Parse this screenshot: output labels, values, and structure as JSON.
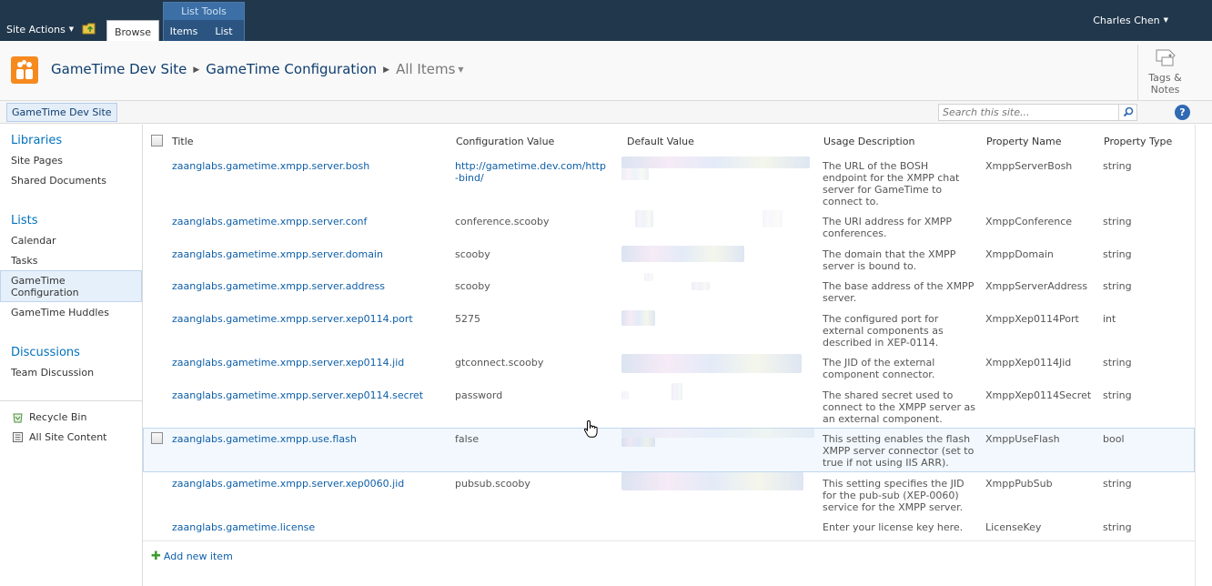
{
  "ribbon": {
    "site_actions": "Site Actions",
    "tab_browse": "Browse",
    "list_tools_title": "List Tools",
    "tab_items": "Items",
    "tab_list": "List",
    "user": "Charles Chen"
  },
  "breadcrumb": {
    "site": "GameTime Dev Site",
    "list": "GameTime Configuration",
    "view": "All Items"
  },
  "tags_notes": {
    "line1": "Tags &",
    "line2": "Notes"
  },
  "topnav": {
    "site": "GameTime Dev Site",
    "search_placeholder": "Search this site...",
    "help": "?"
  },
  "quick_launch": {
    "libraries_heading": "Libraries",
    "libraries": [
      "Site Pages",
      "Shared Documents"
    ],
    "lists_heading": "Lists",
    "lists": [
      "Calendar",
      "Tasks",
      "GameTime Configuration",
      "GameTime Huddles"
    ],
    "discussions_heading": "Discussions",
    "discussions": [
      "Team Discussion"
    ],
    "recycle_bin": "Recycle Bin",
    "all_site_content": "All Site Content"
  },
  "columns": {
    "title": "Title",
    "config_value": "Configuration Value",
    "default_value": "Default Value",
    "usage_description": "Usage Description",
    "property_name": "Property Name",
    "property_type": "Property Type"
  },
  "rows": [
    {
      "title": "zaanglabs.gametime.xmpp.server.bosh",
      "value": "http://gametime.dev.com/http-bind/",
      "value_line1": "http://gametime.dev.com/http",
      "value_line2": "-bind/",
      "desc": "The URL of the BOSH endpoint for the XMPP chat server for GameTime to connect to.",
      "prop": "XmppServerBosh",
      "type": "string"
    },
    {
      "title": "zaanglabs.gametime.xmpp.server.conf",
      "value": "conference.scooby",
      "desc": "The URI address for XMPP conferences.",
      "prop": "XmppConference",
      "type": "string"
    },
    {
      "title": "zaanglabs.gametime.xmpp.server.domain",
      "value": "scooby",
      "desc": "The domain that the XMPP server is bound to.",
      "prop": "XmppDomain",
      "type": "string"
    },
    {
      "title": "zaanglabs.gametime.xmpp.server.address",
      "value": "scooby",
      "desc": "The base address of the XMPP server.",
      "prop": "XmppServerAddress",
      "type": "string"
    },
    {
      "title": "zaanglabs.gametime.xmpp.server.xep0114.port",
      "value": "5275",
      "desc": "The configured port for external components as described in XEP-0114.",
      "prop": "XmppXep0114Port",
      "type": "int"
    },
    {
      "title": "zaanglabs.gametime.xmpp.server.xep0114.jid",
      "value": "gtconnect.scooby",
      "desc": "The JID of the external component connector.",
      "prop": "XmppXep0114Jid",
      "type": "string"
    },
    {
      "title": "zaanglabs.gametime.xmpp.server.xep0114.secret",
      "value": "password",
      "desc": "The shared secret used to connect to the XMPP server as an external component.",
      "prop": "XmppXep0114Secret",
      "type": "string"
    },
    {
      "title": "zaanglabs.gametime.xmpp.use.flash",
      "value": "false",
      "desc": "This setting enables the flash XMPP server connector (set to true if not using IIS ARR).",
      "prop": "XmppUseFlash",
      "type": "bool"
    },
    {
      "title": "zaanglabs.gametime.xmpp.server.xep0060.jid",
      "value": "pubsub.scooby",
      "desc": "This setting specifies the JID for the pub-sub (XEP-0060) service for the XMPP server.",
      "prop": "XmppPubSub",
      "type": "string"
    },
    {
      "title": "zaanglabs.gametime.license",
      "value": "",
      "desc": "Enter your license key here.",
      "prop": "LicenseKey",
      "type": "string"
    }
  ],
  "add_new_item": "Add new item",
  "colors": {
    "ribbon_bg": "#21374c",
    "list_tools_bg": "#2b5481",
    "link": "#0e5fa8",
    "heading_link": "#0072bc",
    "logo": "#f68a1e",
    "selected_row": "#f2f8fd"
  },
  "icons": [
    "navigate-up-icon",
    "site-logo-icon",
    "tags-notes-icon",
    "search-icon",
    "help-icon",
    "recycle-bin-icon",
    "all-site-content-icon",
    "add-icon",
    "hand-cursor-icon"
  ]
}
